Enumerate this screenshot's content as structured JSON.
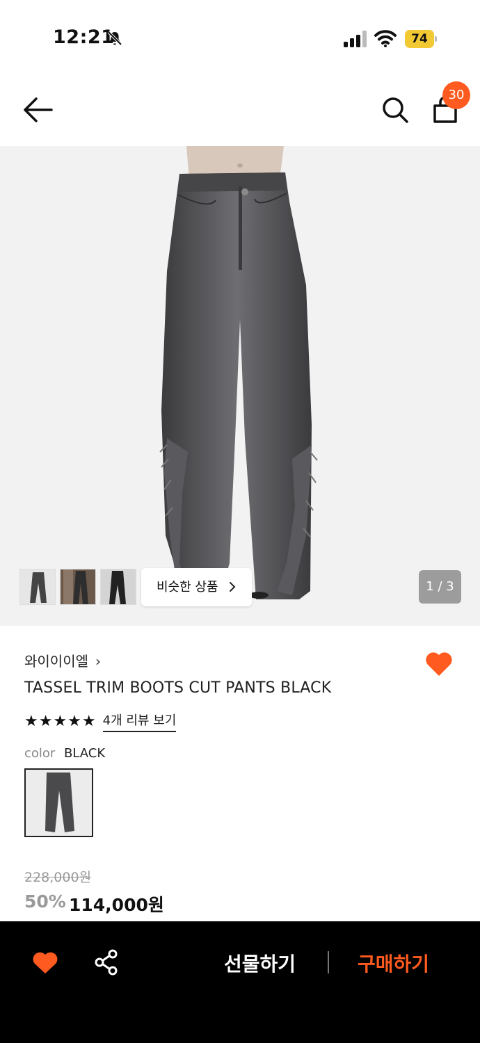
{
  "status_bar": {
    "time": "12:21",
    "battery": "74"
  },
  "header": {
    "cart_count": "30"
  },
  "gallery": {
    "similar_label": "비슷한 상품",
    "page_counter": "1 / 3"
  },
  "product": {
    "brand": "와이이이엘",
    "title": "TASSEL TRIM BOOTS CUT PANTS BLACK",
    "stars": "★★★★★",
    "rating_value": 5,
    "review_link": "4개 리뷰 보기",
    "color_label": "color",
    "color_value": "BLACK",
    "original_price": "228,000원",
    "discount": "50%",
    "price": "114,000원"
  },
  "bottom_bar": {
    "gift_label": "선물하기",
    "buy_label": "구매하기"
  },
  "colors": {
    "accent": "#ff5a1f",
    "battery": "#f2c933"
  }
}
